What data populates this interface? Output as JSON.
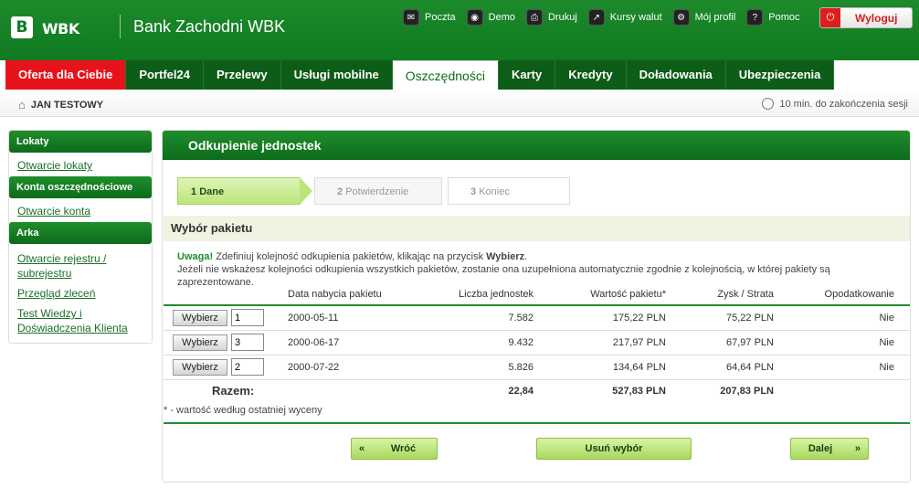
{
  "header": {
    "logo_mark": "B",
    "logo_text": "WBK",
    "bank_name": "Bank Zachodni WBK",
    "links": [
      {
        "label": "Poczta",
        "icon": "mail-icon",
        "glyph": "✉"
      },
      {
        "label": "Demo",
        "icon": "demo-icon",
        "glyph": "◉"
      },
      {
        "label": "Drukuj",
        "icon": "print-icon",
        "glyph": "⎙"
      },
      {
        "label": "Kursy walut",
        "icon": "chart-icon",
        "glyph": "↗"
      },
      {
        "label": "Mój profil",
        "icon": "gear-icon",
        "glyph": "⚙"
      },
      {
        "label": "Pomoc",
        "icon": "help-icon",
        "glyph": "?"
      }
    ],
    "logout": "Wyloguj"
  },
  "tabs": [
    {
      "label": "Oferta dla Ciebie",
      "style": "red"
    },
    {
      "label": "Portfel24",
      "style": ""
    },
    {
      "label": "Przelewy",
      "style": ""
    },
    {
      "label": "Usługi mobilne",
      "style": ""
    },
    {
      "label": "Oszczędności",
      "style": "active"
    },
    {
      "label": "Karty",
      "style": ""
    },
    {
      "label": "Kredyty",
      "style": ""
    },
    {
      "label": "Doładowania",
      "style": ""
    },
    {
      "label": "Ubezpieczenia",
      "style": ""
    }
  ],
  "userbar": {
    "user": "JAN TESTOWY",
    "session": "10 min. do zakończenia sesji"
  },
  "sidebar": {
    "lokaty": "Lokaty",
    "otwarcie_lokaty": "Otwarcie lokaty",
    "konta": "Konta oszczędnościowe",
    "otwarcie_konta": "Otwarcie konta",
    "arka": "Arka",
    "arka_links": [
      "Otwarcie rejestru / subrejestru",
      "Przegląd zleceń",
      "Test Wiedzy i Doświadczenia Klienta"
    ]
  },
  "main": {
    "title": "Odkupienie jednostek",
    "steps": {
      "s1_num": "1",
      "s1": "Dane",
      "s2_num": "2",
      "s2": "Potwierdzenie",
      "s3_num": "3",
      "s3": "Koniec"
    },
    "section_title": "Wybór pakietu",
    "note_prefix": "Uwaga!",
    "note_line1_a": "Zdefiniuj kolejność odkupienia pakietów, klikając na przycisk",
    "note_line1_b": "Wybierz",
    "note_line2": "Jeżeli nie wskażesz kolejności odkupienia wszystkich pakietów, zostanie ona uzupełniona automatycznie zgodnie z kolejnością, w której pakiety są zaprezentowane.",
    "table": {
      "headers": [
        "Data nabycia pakietu",
        "Liczba jednostek",
        "Wartość pakietu*",
        "Zysk / Strata",
        "Opodatkowanie"
      ],
      "rows": [
        {
          "button": "Wybierz",
          "order": "1",
          "date": "2000-05-11",
          "qty": "7.582",
          "value": "175,22 PLN",
          "pl": "75,22 PLN",
          "tax": "Nie"
        },
        {
          "button": "Wybierz",
          "order": "3",
          "date": "2000-06-17",
          "qty": "9.432",
          "value": "217,97 PLN",
          "pl": "67,97 PLN",
          "tax": "Nie"
        },
        {
          "button": "Wybierz",
          "order": "2",
          "date": "2000-07-22",
          "qty": "5.826",
          "value": "134,64 PLN",
          "pl": "64,64 PLN",
          "tax": "Nie"
        }
      ],
      "total_label": "Razem:",
      "total_qty": "22,84",
      "total_value": "527,83 PLN",
      "total_pl": "207,83 PLN"
    },
    "footnote": "* - wartość według ostatniej wyceny",
    "buttons": {
      "back": "Wróć",
      "clear": "Usuń wybór",
      "next": "Dalej"
    }
  }
}
